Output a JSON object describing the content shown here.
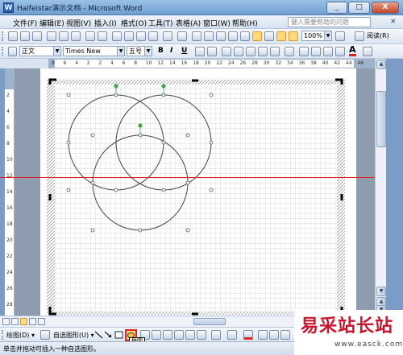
{
  "window": {
    "title": "Haifeistar演示文档 - Microsoft Word",
    "icon_letter": "W",
    "minimize_label": "_",
    "maximize_label": "□",
    "close_label": "X"
  },
  "menubar": {
    "items": [
      {
        "label": "文件(F)"
      },
      {
        "label": "编辑(E)"
      },
      {
        "label": "视图(V)"
      },
      {
        "label": "插入(I)"
      },
      {
        "label": "格式(O)"
      },
      {
        "label": "工具(T)"
      },
      {
        "label": "表格(A)"
      },
      {
        "label": "窗口(W)"
      },
      {
        "label": "帮助(H)"
      }
    ],
    "ask_placeholder": "键入需要帮助的问题",
    "close_doc_label": "×"
  },
  "standard_toolbar": {
    "zoom_value": "100%",
    "read_mode_label": "阅读(R)"
  },
  "format_toolbar": {
    "style_value": "正文",
    "font_value": "Times New Roman",
    "size_value": "五号",
    "bold_label": "B",
    "italic_label": "I",
    "underline_label": "U",
    "font_color_label": "A"
  },
  "ruler": {
    "h_labels": [
      "8",
      "6",
      "4",
      "2",
      "2",
      "4",
      "6",
      "8",
      "10",
      "12",
      "14",
      "16",
      "18",
      "20",
      "22",
      "24",
      "26",
      "28",
      "30",
      "32",
      "34",
      "36",
      "38",
      "40",
      "42",
      "44",
      "46"
    ],
    "v_labels": [
      "2",
      "4",
      "6",
      "8",
      "10",
      "12",
      "14",
      "16",
      "18",
      "20",
      "22",
      "24",
      "26",
      "28"
    ]
  },
  "drawing_toolbar": {
    "draw_label": "绘图(D) ▾",
    "autoshapes_label": "自选图形(U) ▾",
    "oval_tooltip": "椭圆"
  },
  "statusbar": {
    "text": "单击并拖动可插入一种自选图形。"
  },
  "watermark": {
    "brand": "易采站长站",
    "url": "www.easck.com"
  },
  "colors": {
    "red_guide_line": "#e0231c",
    "selection_handle_green": "#3cb43c",
    "grid": "#c9c9c9",
    "watermark_red": "#c8142c"
  }
}
